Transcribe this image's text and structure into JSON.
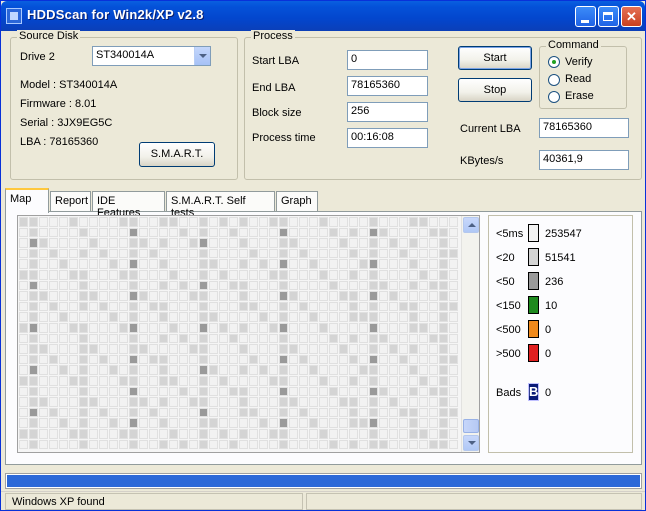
{
  "window": {
    "title": "HDDScan for Win2k/XP  v2.8"
  },
  "source_disk": {
    "title": "Source Disk",
    "drive_label": "Drive  2",
    "drive_value": "ST340014A",
    "model": "Model : ST340014A",
    "firmware": "Firmware : 8.01",
    "serial": "Serial : 3JX9EG5C",
    "lba": "LBA :  78165360",
    "smart_button": "S.M.A.R.T."
  },
  "process": {
    "title": "Process",
    "start_lba_label": "Start LBA",
    "start_lba": "0",
    "end_lba_label": "End LBA",
    "end_lba": "78165360",
    "block_size_label": "Block size",
    "block_size": "256",
    "process_time_label": "Process time",
    "process_time": "00:16:08",
    "start_button": "Start",
    "stop_button": "Stop",
    "current_lba_label": "Current LBA",
    "current_lba": "78165360",
    "kbytes_label": "KBytes/s",
    "kbytes": "40361,9"
  },
  "command": {
    "title": "Command",
    "options": [
      {
        "label": "Verify",
        "checked": true
      },
      {
        "label": "Read",
        "checked": false
      },
      {
        "label": "Erase",
        "checked": false
      }
    ]
  },
  "tabs": [
    {
      "label": "Map",
      "active": true
    },
    {
      "label": "Report",
      "active": false
    },
    {
      "label": "IDE Features",
      "active": false
    },
    {
      "label": "S.M.A.R.T. Self tests",
      "active": false
    },
    {
      "label": "Graph",
      "active": false
    }
  ],
  "legend": {
    "items": [
      {
        "label": "<5ms",
        "count": "253547",
        "color": "#f2f2f2"
      },
      {
        "label": "<20",
        "count": "51541",
        "color": "#d4d4d4"
      },
      {
        "label": "<50",
        "count": "236",
        "color": "#9a9a9a"
      },
      {
        "label": "<150",
        "count": "10",
        "color": "#1e8a1e"
      },
      {
        "label": "<500",
        "count": "0",
        "color": "#f08a1c"
      },
      {
        "label": ">500",
        "count": "0",
        "color": "#e02020"
      }
    ],
    "bads_label": "Bads",
    "bads_glyph": "B",
    "bads_count": "0",
    "bads_color": "#0a1a78"
  },
  "progress": {
    "fraction": 1.0
  },
  "status": {
    "message": "Windows XP found",
    "secondary": ""
  }
}
